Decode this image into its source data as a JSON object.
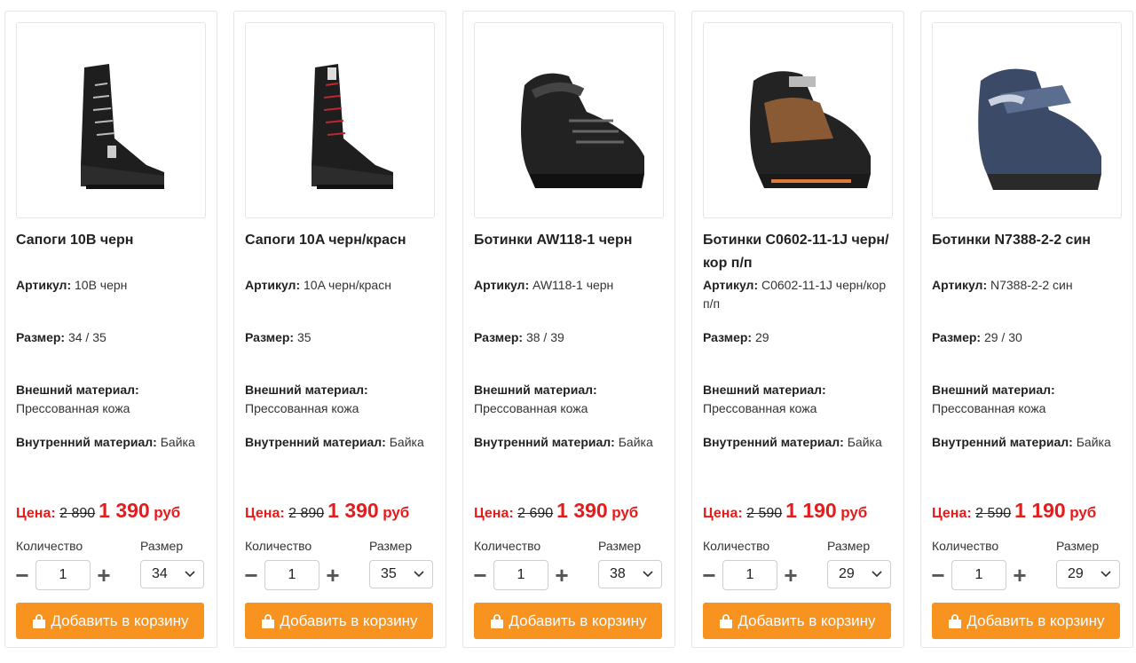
{
  "labels": {
    "article": "Артикул:",
    "size": "Размер:",
    "outer": "Внешний материал:",
    "inner": "Внутренний материал:",
    "price": "Цена:",
    "quantity": "Количество",
    "size_select": "Размер",
    "add_to_cart": "Добавить в корзину",
    "currency": "руб"
  },
  "colors": {
    "accent": "#f7931e",
    "price": "#e41c1c"
  },
  "products": [
    {
      "title": "Сапоги 10B черн",
      "article": "10B черн",
      "size": "34 / 35",
      "outer": "Прессованная кожа",
      "inner": "Байка",
      "old_price": "2 890",
      "price": "1 390",
      "qty": "1",
      "selected_size": "34",
      "image_icon": "ankle-boot-black-icon"
    },
    {
      "title": "Сапоги 10A черн/красн",
      "article": "10A черн/красн",
      "size": "35",
      "outer": "Прессованная кожа",
      "inner": "Байка",
      "old_price": "2 890",
      "price": "1 390",
      "qty": "1",
      "selected_size": "35",
      "image_icon": "ankle-boot-red-laces-icon"
    },
    {
      "title": "Ботинки AW118-1 черн",
      "article": "AW118-1 черн",
      "size": "38 / 39",
      "outer": "Прессованная кожа",
      "inner": "Байка",
      "old_price": "2 690",
      "price": "1 390",
      "qty": "1",
      "selected_size": "38",
      "image_icon": "sneaker-boot-black-icon"
    },
    {
      "title": "Ботинки C0602-11-1J черн/кор п/п",
      "article": "C0602-11-1J черн/кор п/п",
      "size": "29",
      "outer": "Прессованная кожа",
      "inner": "Байка",
      "old_price": "2 590",
      "price": "1 190",
      "qty": "1",
      "selected_size": "29",
      "image_icon": "sneaker-boot-brown-icon"
    },
    {
      "title": "Ботинки N7388-2-2 син",
      "article": "N7388-2-2 син",
      "size": "29 / 30",
      "outer": "Прессованная кожа",
      "inner": "Байка",
      "old_price": "2 590",
      "price": "1 190",
      "qty": "1",
      "selected_size": "29",
      "image_icon": "sneaker-boot-blue-icon"
    }
  ]
}
